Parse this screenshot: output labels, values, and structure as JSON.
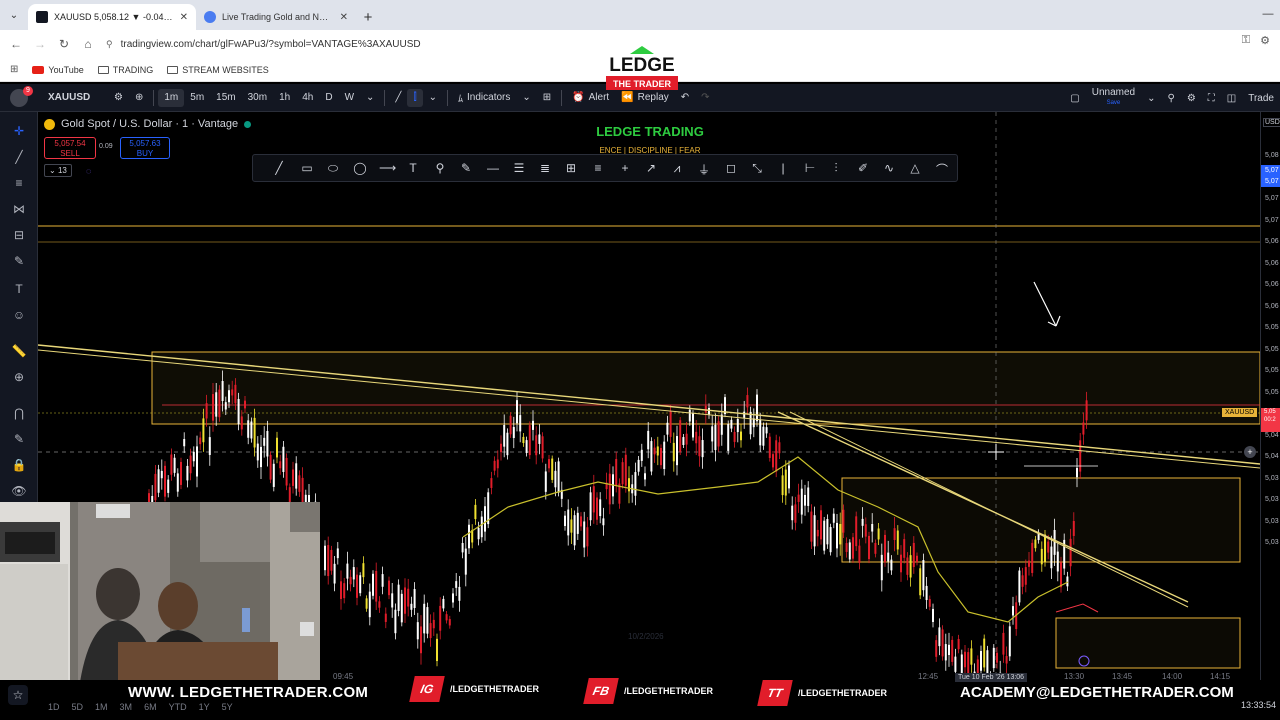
{
  "browser": {
    "tabs": [
      {
        "title": "XAUUSD 5,058.12 ▼ -0.04% Ur",
        "active": true
      },
      {
        "title": "Live Trading Gold and NAS100",
        "active": false
      }
    ],
    "url": "tradingview.com/chart/glFwAPu3/?symbol=VANTAGE%3AXAUUSD",
    "bookmarks": [
      "YouTube",
      "TRADING",
      "STREAM WEBSITES"
    ]
  },
  "toolbar": {
    "avatar_badge": "9",
    "symbol": "XAUUSD",
    "intervals": [
      "1m",
      "5m",
      "15m",
      "30m",
      "1h",
      "4h",
      "D",
      "W"
    ],
    "indicators_label": "Indicators",
    "alert_label": "Alert",
    "replay_label": "Replay",
    "layout_name": "Unnamed",
    "layout_sub": "Save",
    "trade_label": "Trade"
  },
  "logo": {
    "text": "LEDGE",
    "sub": "THE TRADER"
  },
  "chart": {
    "legend_title": "Gold Spot / U.S. Dollar · 1 · Vantage",
    "sell_price": "5,057.54",
    "sell_label": "SELL",
    "spread": "0.09",
    "buy_price": "5,057.63",
    "buy_label": "BUY",
    "collapse_count": "13",
    "brand": "LEDGE TRADING",
    "tagline": "ENCE | DISCIPLINE | FEAR",
    "currency": "USD",
    "price_ticks": [
      "5,08",
      "5,07",
      "5,07",
      "5,07",
      "5,06",
      "5,06",
      "5,06",
      "5,06",
      "5,05",
      "5,05",
      "5,05",
      "5,05",
      "5,04",
      "5,04",
      "5,04",
      "5,03",
      "5,03",
      "5,03",
      "5,03"
    ],
    "price_blue": [
      "5,07",
      "5,07"
    ],
    "price_red": [
      "5,05",
      "00:2"
    ],
    "xau_tag": "XAUUSD",
    "time_labels": [
      "09:45",
      "12:45",
      "13:30",
      "13:45",
      "14:00",
      "14:15"
    ],
    "date_label": "Tue 10 Feb '26  13:06",
    "watermark": "10/2/2026"
  },
  "bottom": {
    "ranges": [
      "1D",
      "5D",
      "1M",
      "3M",
      "6M",
      "YTD",
      "1Y",
      "5Y"
    ],
    "clock": "13:33:54",
    "site": "WWW. LEDGETHETRADER.COM",
    "ig": "IG",
    "ig_name": "/LEDGETHETRADER",
    "fb": "FB",
    "fb_name": "/LEDGETHETRADER",
    "tt": "TT",
    "tt_name": "/LEDGETHETRADER",
    "email": "ACADEMY@LEDGETHETRADER.COM"
  },
  "colors": {
    "up": "#ffffff",
    "down": "#e11d2a",
    "wick_high": "#f0e130",
    "trend": "#e8d77a",
    "box": "#e8b339",
    "ma": "#c9c02c"
  }
}
